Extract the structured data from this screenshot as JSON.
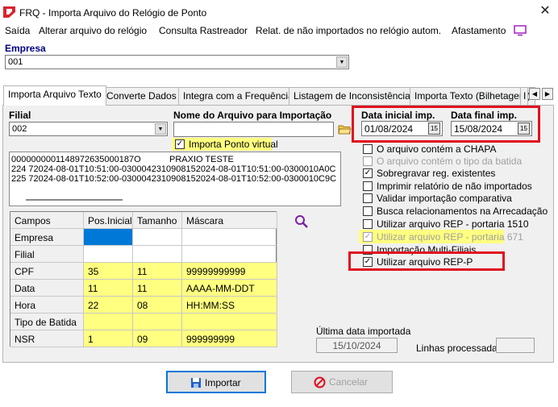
{
  "window": {
    "title": "FRQ - Importa Arquivo do Relógio de Ponto"
  },
  "menu": [
    "Saída",
    "Alterar arquivo do relógio",
    "Consulta Rastreador",
    "Relat. de não importados no relógio autom.",
    "Afastamento"
  ],
  "empresa": {
    "label": "Empresa",
    "value": "001"
  },
  "tabs": [
    "Importa Arquivo Texto",
    "Converte Dados",
    "Integra com a Frequência",
    "Listagem de Inconsistências",
    "Importa Texto (Bilhetagem)",
    "I"
  ],
  "filial": {
    "label": "Filial",
    "value": "002"
  },
  "nome_arquivo": {
    "label": "Nome do Arquivo para Importação",
    "value": ""
  },
  "importa_ponto_virtual": {
    "label": "Importa Ponto virtual",
    "checked": true
  },
  "data_inicial": {
    "label": "Data inicial imp.",
    "value": "01/08/2024"
  },
  "data_final": {
    "label": "Data final imp.",
    "value": "15/08/2024"
  },
  "file_lines": [
    {
      "c1": "0000000001148972635000187O",
      "c2": "PRAXIO TESTE"
    },
    {
      "c1": "224    72024-08-01T10:51:00-0300042310908152024-08-01T10:51:00-0300010A0C",
      "c2": ""
    },
    {
      "c1": "225    72024-08-01T10:52:00-0300042310908152024-08-01T10:52:00-0300010C9C",
      "c2": ""
    }
  ],
  "grid": {
    "headers": [
      "Campos",
      "Pos.Inicial",
      "Tamanho",
      "Máscara"
    ],
    "rows": [
      {
        "campo": "Empresa",
        "pos": "",
        "tam": "",
        "mask": ""
      },
      {
        "campo": "Filial",
        "pos": "",
        "tam": "",
        "mask": ""
      },
      {
        "campo": "CPF",
        "pos": "35",
        "tam": "11",
        "mask": "99999999999"
      },
      {
        "campo": "Data",
        "pos": "11",
        "tam": "11",
        "mask": "AAAA-MM-DDT"
      },
      {
        "campo": "Hora",
        "pos": "22",
        "tam": "08",
        "mask": "HH:MM:SS"
      },
      {
        "campo": "Tipo de Batida",
        "pos": "",
        "tam": "",
        "mask": ""
      },
      {
        "campo": "NSR",
        "pos": "1",
        "tam": "09",
        "mask": "999999999"
      }
    ]
  },
  "options": [
    {
      "label": "O arquivo contém a CHAPA",
      "checked": false,
      "disabled": false
    },
    {
      "label": "O arquivo contém o tipo da batida",
      "checked": false,
      "disabled": true
    },
    {
      "label": "Sobregravar reg. existentes",
      "checked": true,
      "disabled": false
    },
    {
      "label": "Imprimir relatório de não importados",
      "checked": false,
      "disabled": false
    },
    {
      "label": "Validar importação comparativa",
      "checked": false,
      "disabled": false
    },
    {
      "label": "Busca relacionamentos na Arrecadação",
      "checked": false,
      "disabled": false
    },
    {
      "label": "Utilizar arquivo REP - portaria 1510",
      "checked": false,
      "disabled": false
    },
    {
      "label": "Utilizar arquivo REP - portaria 671",
      "checked": true,
      "disabled": true
    },
    {
      "label": "Importação Multi-Filiais",
      "checked": false,
      "disabled": false
    },
    {
      "label": "Utilizar arquivo REP-P",
      "checked": true,
      "disabled": false
    }
  ],
  "ultima_data": {
    "label": "Última data importada",
    "value": "15/10/2024"
  },
  "linhas": {
    "label": "Linhas processadas",
    "value": ""
  },
  "buttons": {
    "importar": "Importar",
    "cancelar": "Cancelar"
  },
  "colors": {
    "highlight_yellow": "#ffff80",
    "red_box": "#e0101e",
    "selection_blue": "#0078d7",
    "label_blue": "#000080"
  }
}
